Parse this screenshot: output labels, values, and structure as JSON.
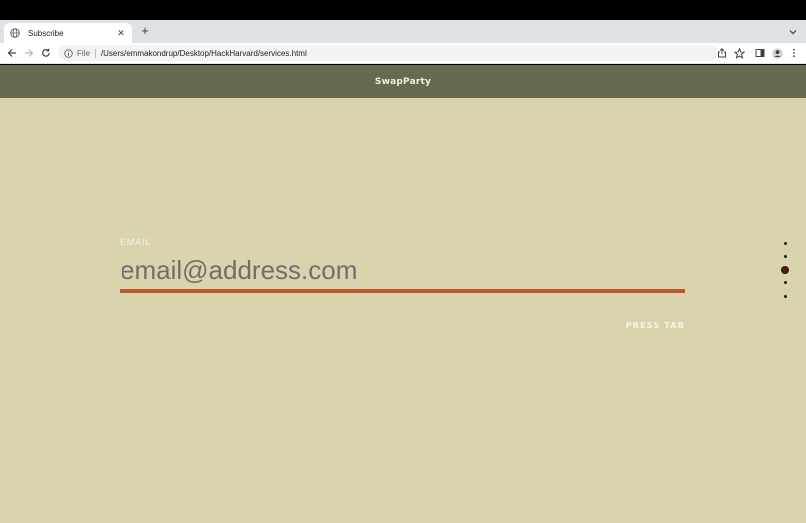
{
  "browser": {
    "tab": {
      "title": "Subscribe",
      "favicon": "globe-icon",
      "close_glyph": "✕"
    },
    "new_tab_glyph": "+",
    "omnibox": {
      "scheme_label": "File",
      "url": "/Users/emmakondrup/Desktop/HackHarvard/services.html"
    }
  },
  "site": {
    "brand": "SwapParty"
  },
  "form": {
    "email_label": "EMAIL",
    "email_placeholder": "email@address.com",
    "hint": "PRESS TAB",
    "accent_color": "#c0562a"
  },
  "pager": {
    "count": 5,
    "active_index": 2
  },
  "colors": {
    "page_background": "#d9d3ae",
    "header_background": "#666b4f"
  }
}
